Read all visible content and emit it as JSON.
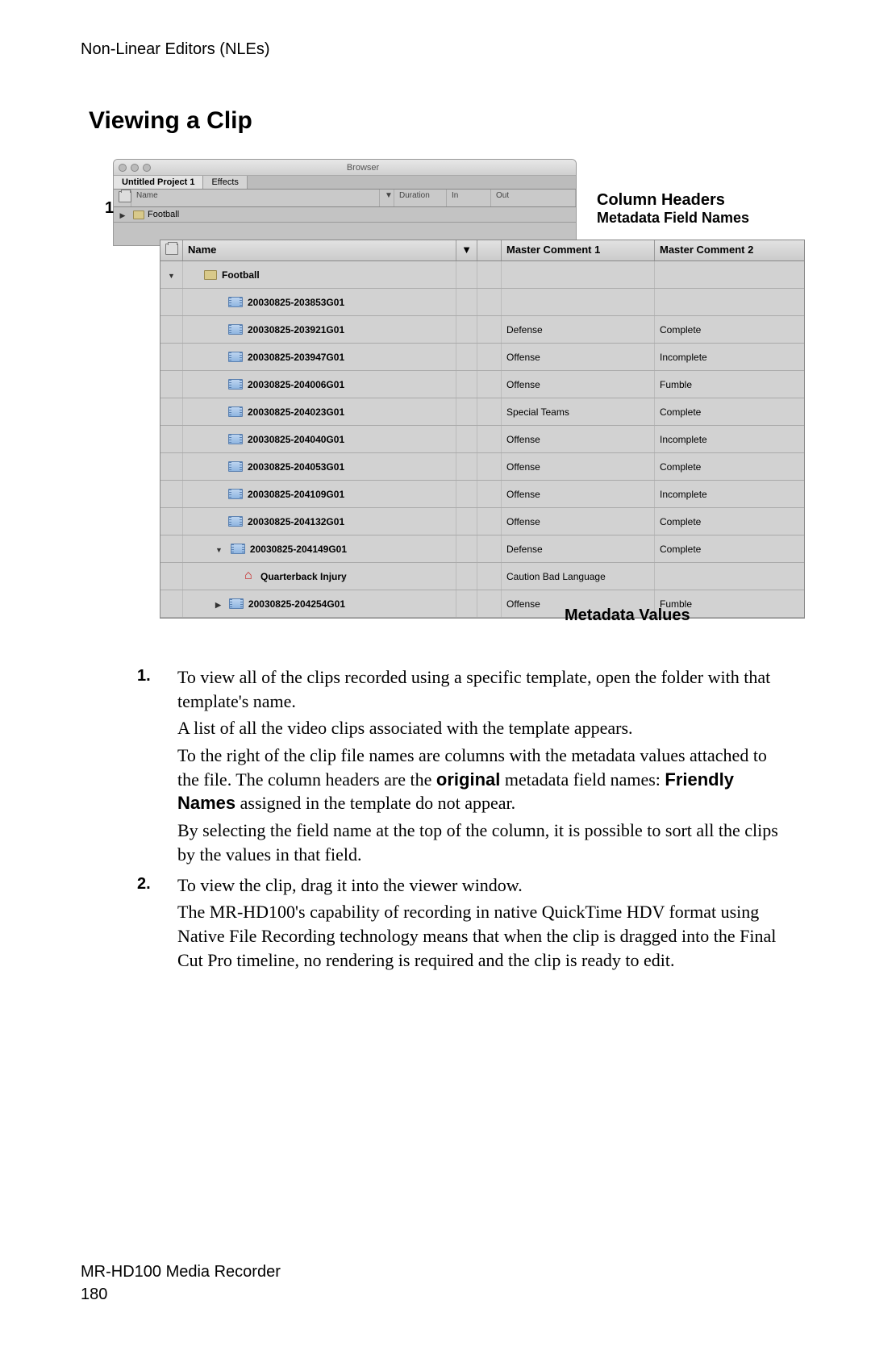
{
  "header": "Non-Linear Editors (NLEs)",
  "section_title": "Viewing a Clip",
  "callout_number": "1",
  "browser": {
    "title": "Browser",
    "tabs": {
      "project": "Untitled Project 1",
      "effects": "Effects"
    },
    "small_headers": {
      "name": "Name",
      "duration": "Duration",
      "in": "In",
      "out": "Out"
    },
    "folder": "Football"
  },
  "annotation": {
    "column_headers": "Column Headers",
    "metadata_field_names": "Metadata Field Names",
    "metadata_values": "Metadata Values"
  },
  "detail": {
    "headers": {
      "name": "Name",
      "mc1": "Master Comment 1",
      "mc2": "Master Comment 2"
    },
    "folder": "Football",
    "rows": [
      {
        "name": "20030825-203853G01",
        "mc1": "",
        "mc2": ""
      },
      {
        "name": "20030825-203921G01",
        "mc1": "Defense",
        "mc2": "Complete"
      },
      {
        "name": "20030825-203947G01",
        "mc1": "Offense",
        "mc2": "Incomplete"
      },
      {
        "name": "20030825-204006G01",
        "mc1": "Offense",
        "mc2": "Fumble"
      },
      {
        "name": "20030825-204023G01",
        "mc1": "Special Teams",
        "mc2": "Complete"
      },
      {
        "name": "20030825-204040G01",
        "mc1": "Offense",
        "mc2": "Incomplete"
      },
      {
        "name": "20030825-204053G01",
        "mc1": "Offense",
        "mc2": "Complete"
      },
      {
        "name": "20030825-204109G01",
        "mc1": "Offense",
        "mc2": "Incomplete"
      },
      {
        "name": "20030825-204132G01",
        "mc1": "Offense",
        "mc2": "Complete"
      }
    ],
    "expanded_row": {
      "name": "20030825-204149G01",
      "mc1": "Defense",
      "mc2": "Complete"
    },
    "marker_row": {
      "name": "Quarterback Injury",
      "mc1": "Caution Bad Language",
      "mc2": ""
    },
    "last_row": {
      "name": "20030825-204254G01",
      "mc1": "Offense",
      "mc2": "Fumble"
    }
  },
  "steps": {
    "s1": {
      "num": "1.",
      "p1": "To view all of the clips recorded using a specific template, open the folder with that template's name.",
      "p2": "A list of all the video clips associated with the template appears.",
      "p3a": "To the right of the clip file names are columns with the metadata values attached to the file. The column headers are the ",
      "original": "original",
      "p3b": " metadata field names: ",
      "friendly": "Friendly Names",
      "p3c": " assigned in the template do not appear.",
      "p4": "By selecting the field name at the top of the column, it is possible to sort all the clips by the values in that field."
    },
    "s2": {
      "num": "2.",
      "p1": "To view the clip, drag it into the viewer window.",
      "p2": "The MR-HD100's capability of recording in native QuickTime HDV format using Native File Recording technology means that when the clip is dragged into the Final Cut Pro timeline, no rendering is required and the clip is ready to edit."
    }
  },
  "footer": {
    "product": "MR-HD100 Media Recorder",
    "page": "180"
  }
}
